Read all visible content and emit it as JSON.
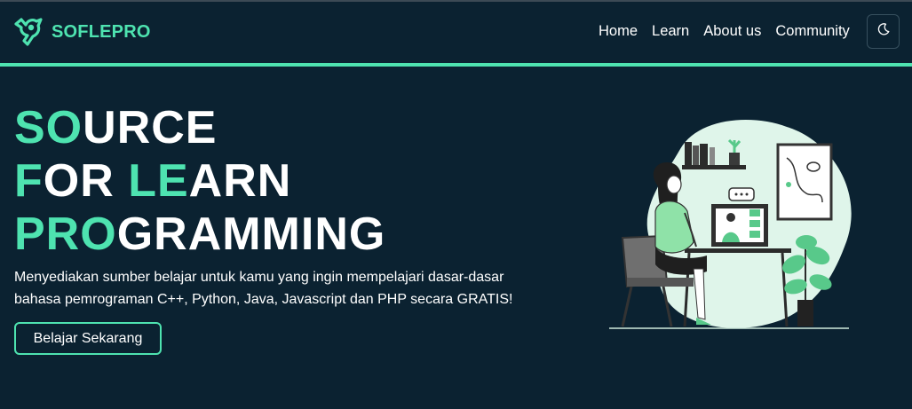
{
  "brand": {
    "name": "SOFLEPRO",
    "logo_icon": "soflepro-logo-icon"
  },
  "nav": {
    "items": [
      {
        "label": "Home"
      },
      {
        "label": "Learn"
      },
      {
        "label": "About us"
      },
      {
        "label": "Community"
      }
    ],
    "theme_toggle_icon": "moon-icon"
  },
  "hero": {
    "title_lines": [
      {
        "highlight": "SO",
        "rest": "URCE"
      },
      {
        "highlight": "F",
        "rest": "OR ",
        "highlight2": "LE",
        "rest2": "ARN"
      },
      {
        "highlight": "PRO",
        "rest": "GRAMMING"
      }
    ],
    "description": "Menyediakan sumber belajar untuk kamu yang ingin mempelajari dasar-dasar bahasa pemrograman C++, Python, Java, Javascript dan PHP secara GRATIS!",
    "cta_label": "Belajar Sekarang",
    "illustration": "woman-at-laptop-video-call-illustration"
  },
  "colors": {
    "background": "#0b2231",
    "accent": "#4ee3b0",
    "text": "#ffffff"
  }
}
